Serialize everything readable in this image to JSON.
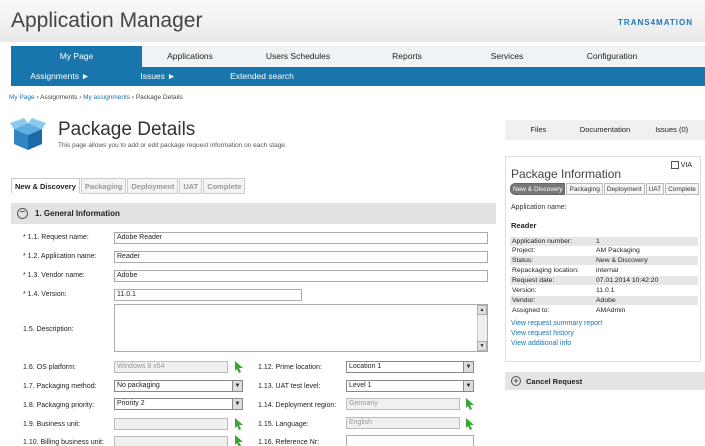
{
  "app": {
    "title": "Application Manager",
    "brand": "TRANS4MATION"
  },
  "nav_main": [
    "My Page",
    "Applications",
    "Users Schedules",
    "Reports",
    "Services",
    "Configuration"
  ],
  "nav_sub": [
    "Assignments ►",
    "Issues ►",
    "Extended search"
  ],
  "breadcrumb": {
    "home": "My Page",
    "sep": " › ",
    "assignments": "Assignments",
    "my_assignments": "My assignments",
    "current": "Package Details"
  },
  "page": {
    "title": "Package Details",
    "subtitle": "This page allows you to add or edit package request information on each stage."
  },
  "stage_tabs": [
    "New & Discovery",
    "Packaging",
    "Deployment",
    "UAT",
    "Complete"
  ],
  "section": {
    "toggle": "−",
    "title": "1. General Information"
  },
  "form": {
    "request_name": {
      "label": "* 1.1. Request name:",
      "value": "Adobe Reader"
    },
    "application_name": {
      "label": "* 1.2. Application name:",
      "value": "Reader"
    },
    "vendor_name": {
      "label": "* 1.3. Vendor name:",
      "value": "Adobe"
    },
    "version": {
      "label": "* 1.4. Version:",
      "value": "11.0.1"
    },
    "description": {
      "label": "1.5. Description:",
      "value": ""
    },
    "os_platform": {
      "label": "1.6. OS platform:",
      "value": "Windows 8 x64"
    },
    "packaging_method": {
      "label": "1.7. Packaging method:",
      "value": "No packaging"
    },
    "packaging_priority": {
      "label": "1.8. Packaging priority:",
      "value": "Priority 2"
    },
    "business_unit": {
      "label": "1.9. Business unit:",
      "value": ""
    },
    "billing_business_unit": {
      "label": "1.10. Billing business unit:",
      "value": ""
    },
    "prime_location": {
      "label": "1.12. Prime location:",
      "value": "Location 1"
    },
    "uat_test_level": {
      "label": "1.13. UAT test level:",
      "value": "Level 1"
    },
    "deployment_region": {
      "label": "1.14. Deployment region:",
      "value": "Germany"
    },
    "language": {
      "label": "1.15. Language:",
      "value": "English"
    },
    "reference_nr": {
      "label": "1.16. Reference Nr:",
      "value": ""
    }
  },
  "right_tabs": [
    "Files",
    "Documentation",
    "Issues (0)"
  ],
  "package_info": {
    "title": "Package Information",
    "via_label": "VIA",
    "tabs": [
      "New & Discovery",
      "Packaging",
      "Deployment",
      "UAT",
      "Complete"
    ],
    "app_name_label": "Application name:",
    "app_name_value": "Reader",
    "rows": [
      {
        "k": "Application number:",
        "v": "1"
      },
      {
        "k": "Project:",
        "v": "AM Packaging"
      },
      {
        "k": "Status:",
        "v": "New & Discovery"
      },
      {
        "k": "Repackaging location:",
        "v": "internal"
      },
      {
        "k": "Request date:",
        "v": "07.01.2014 10:42:20"
      },
      {
        "k": "Version:",
        "v": "11.0.1"
      },
      {
        "k": "Vendor:",
        "v": "Adobe"
      },
      {
        "k": "Assigned to:",
        "v": "AMAdmin"
      }
    ],
    "links": [
      "View request summary report",
      "View request history",
      "View additional info"
    ]
  },
  "cancel": {
    "icon": "+",
    "label": "Cancel Request"
  },
  "colors": {
    "accent": "#1976ac",
    "green_cursor": "#3aa535"
  }
}
